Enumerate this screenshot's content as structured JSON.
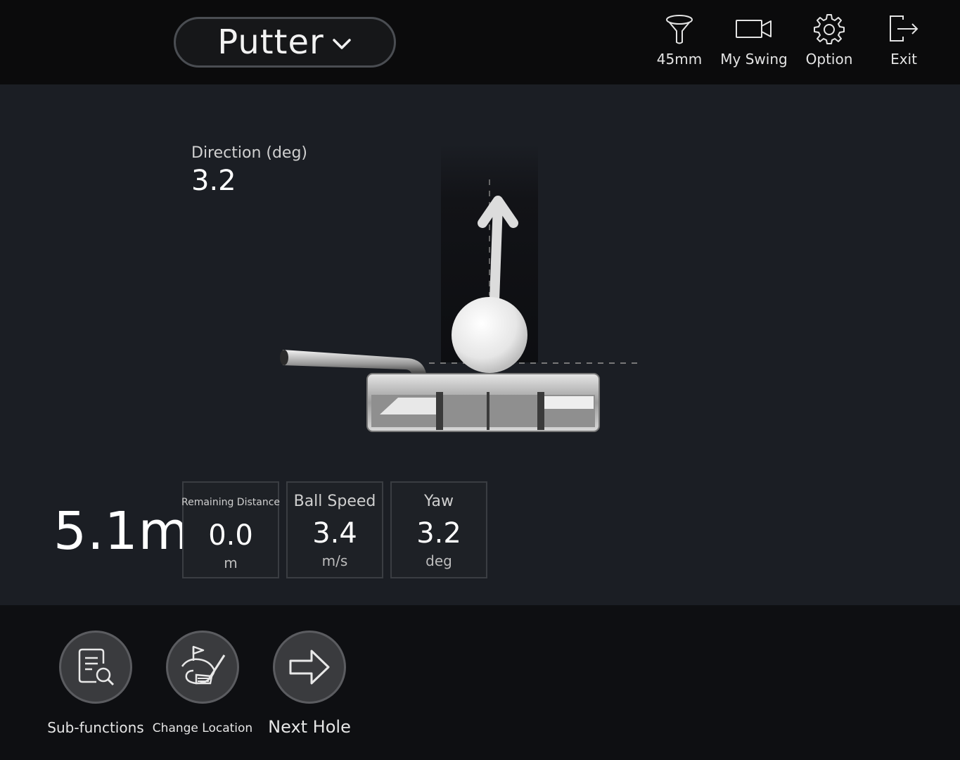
{
  "header": {
    "club": "Putter",
    "actions": [
      {
        "label": "45mm",
        "icon": "tee-icon"
      },
      {
        "label": "My Swing",
        "icon": "camera-icon"
      },
      {
        "label": "Option",
        "icon": "gear-icon"
      },
      {
        "label": "Exit",
        "icon": "exit-icon"
      }
    ]
  },
  "direction": {
    "label": "Direction (deg)",
    "value": "3.2"
  },
  "total_distance": "5.1m",
  "stats": [
    {
      "title": "Remaining Distance",
      "value": "0.0",
      "unit": "m"
    },
    {
      "title": "Ball Speed",
      "value": "3.4",
      "unit": "m/s"
    },
    {
      "title": "Yaw",
      "value": "3.2",
      "unit": "deg"
    }
  ],
  "footer": {
    "buttons": [
      {
        "label": "Sub-functions",
        "icon": "document-search-icon"
      },
      {
        "label": "Change Location",
        "icon": "course-flag-icon"
      },
      {
        "label": "Next Hole",
        "icon": "arrow-right-icon"
      }
    ]
  },
  "colors": {
    "background": "#1b1e24",
    "topbar": "#0b0b0c",
    "bottombar": "#0e0f12"
  }
}
